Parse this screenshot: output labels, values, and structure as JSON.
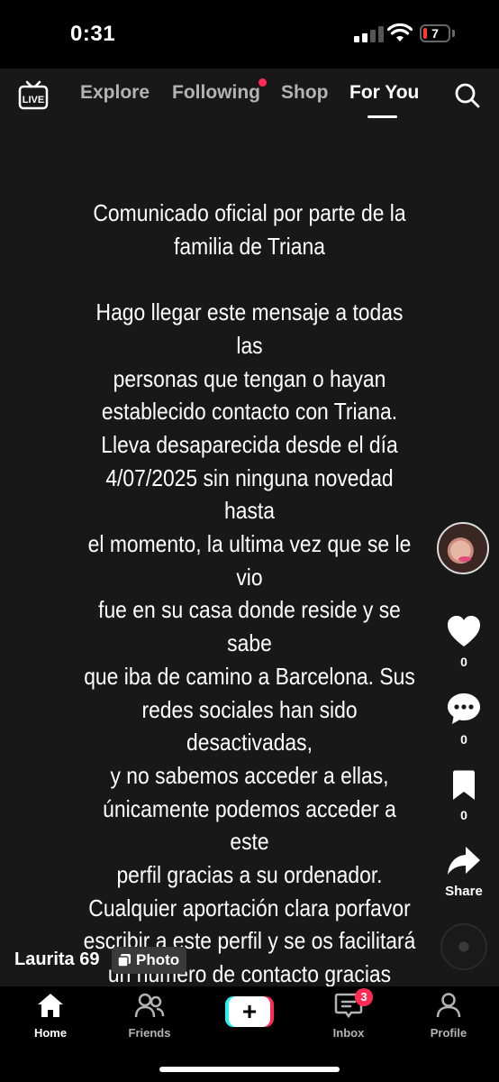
{
  "status_bar": {
    "time": "0:31",
    "battery_level": "7",
    "battery_color": "#ff3b30"
  },
  "top_nav": {
    "live_label": "LIVE",
    "tabs": [
      {
        "label": "Explore"
      },
      {
        "label": "Following"
      },
      {
        "label": "Shop"
      },
      {
        "label": "For You"
      }
    ],
    "active_tab": "For You",
    "following_notification_color": "#fe2c55"
  },
  "post": {
    "title": "Comunicado oficial por parte de la\nfamilia de Triana",
    "body": "Hago llegar este mensaje a todas las\npersonas que tengan o hayan\nestablecido contacto con Triana.\nLleva desaparecida desde el día\n4/07/2025 sin ninguna novedad hasta\nel momento, la ultima vez que se le vio\nfue en su casa donde reside y se sabe\nque iba de camino a Barcelona. Sus\nredes sociales han sido desactivadas,\ny no sabemos acceder a ellas,\núnicamente podemos acceder a este\nperfil gracias a su ordenador.\nCualquier aportación clara porfavor\nescribir a este perfil y se os facilitará\nun numero de contacto gracias",
    "author": "Laurita 69",
    "type_badge": "Photo"
  },
  "rail": {
    "likes": "0",
    "comments": "0",
    "saves": "0",
    "share_label": "Share"
  },
  "bottom_nav": {
    "items": [
      {
        "label": "Home",
        "icon": "home-icon"
      },
      {
        "label": "Friends",
        "icon": "friends-icon"
      },
      {
        "label": "",
        "icon": "create-plus-icon"
      },
      {
        "label": "Inbox",
        "icon": "inbox-icon"
      },
      {
        "label": "Profile",
        "icon": "profile-icon"
      }
    ],
    "inbox_badge": "3",
    "brand_colors": {
      "cyan": "#25f4ee",
      "pink": "#fe2c55"
    }
  }
}
